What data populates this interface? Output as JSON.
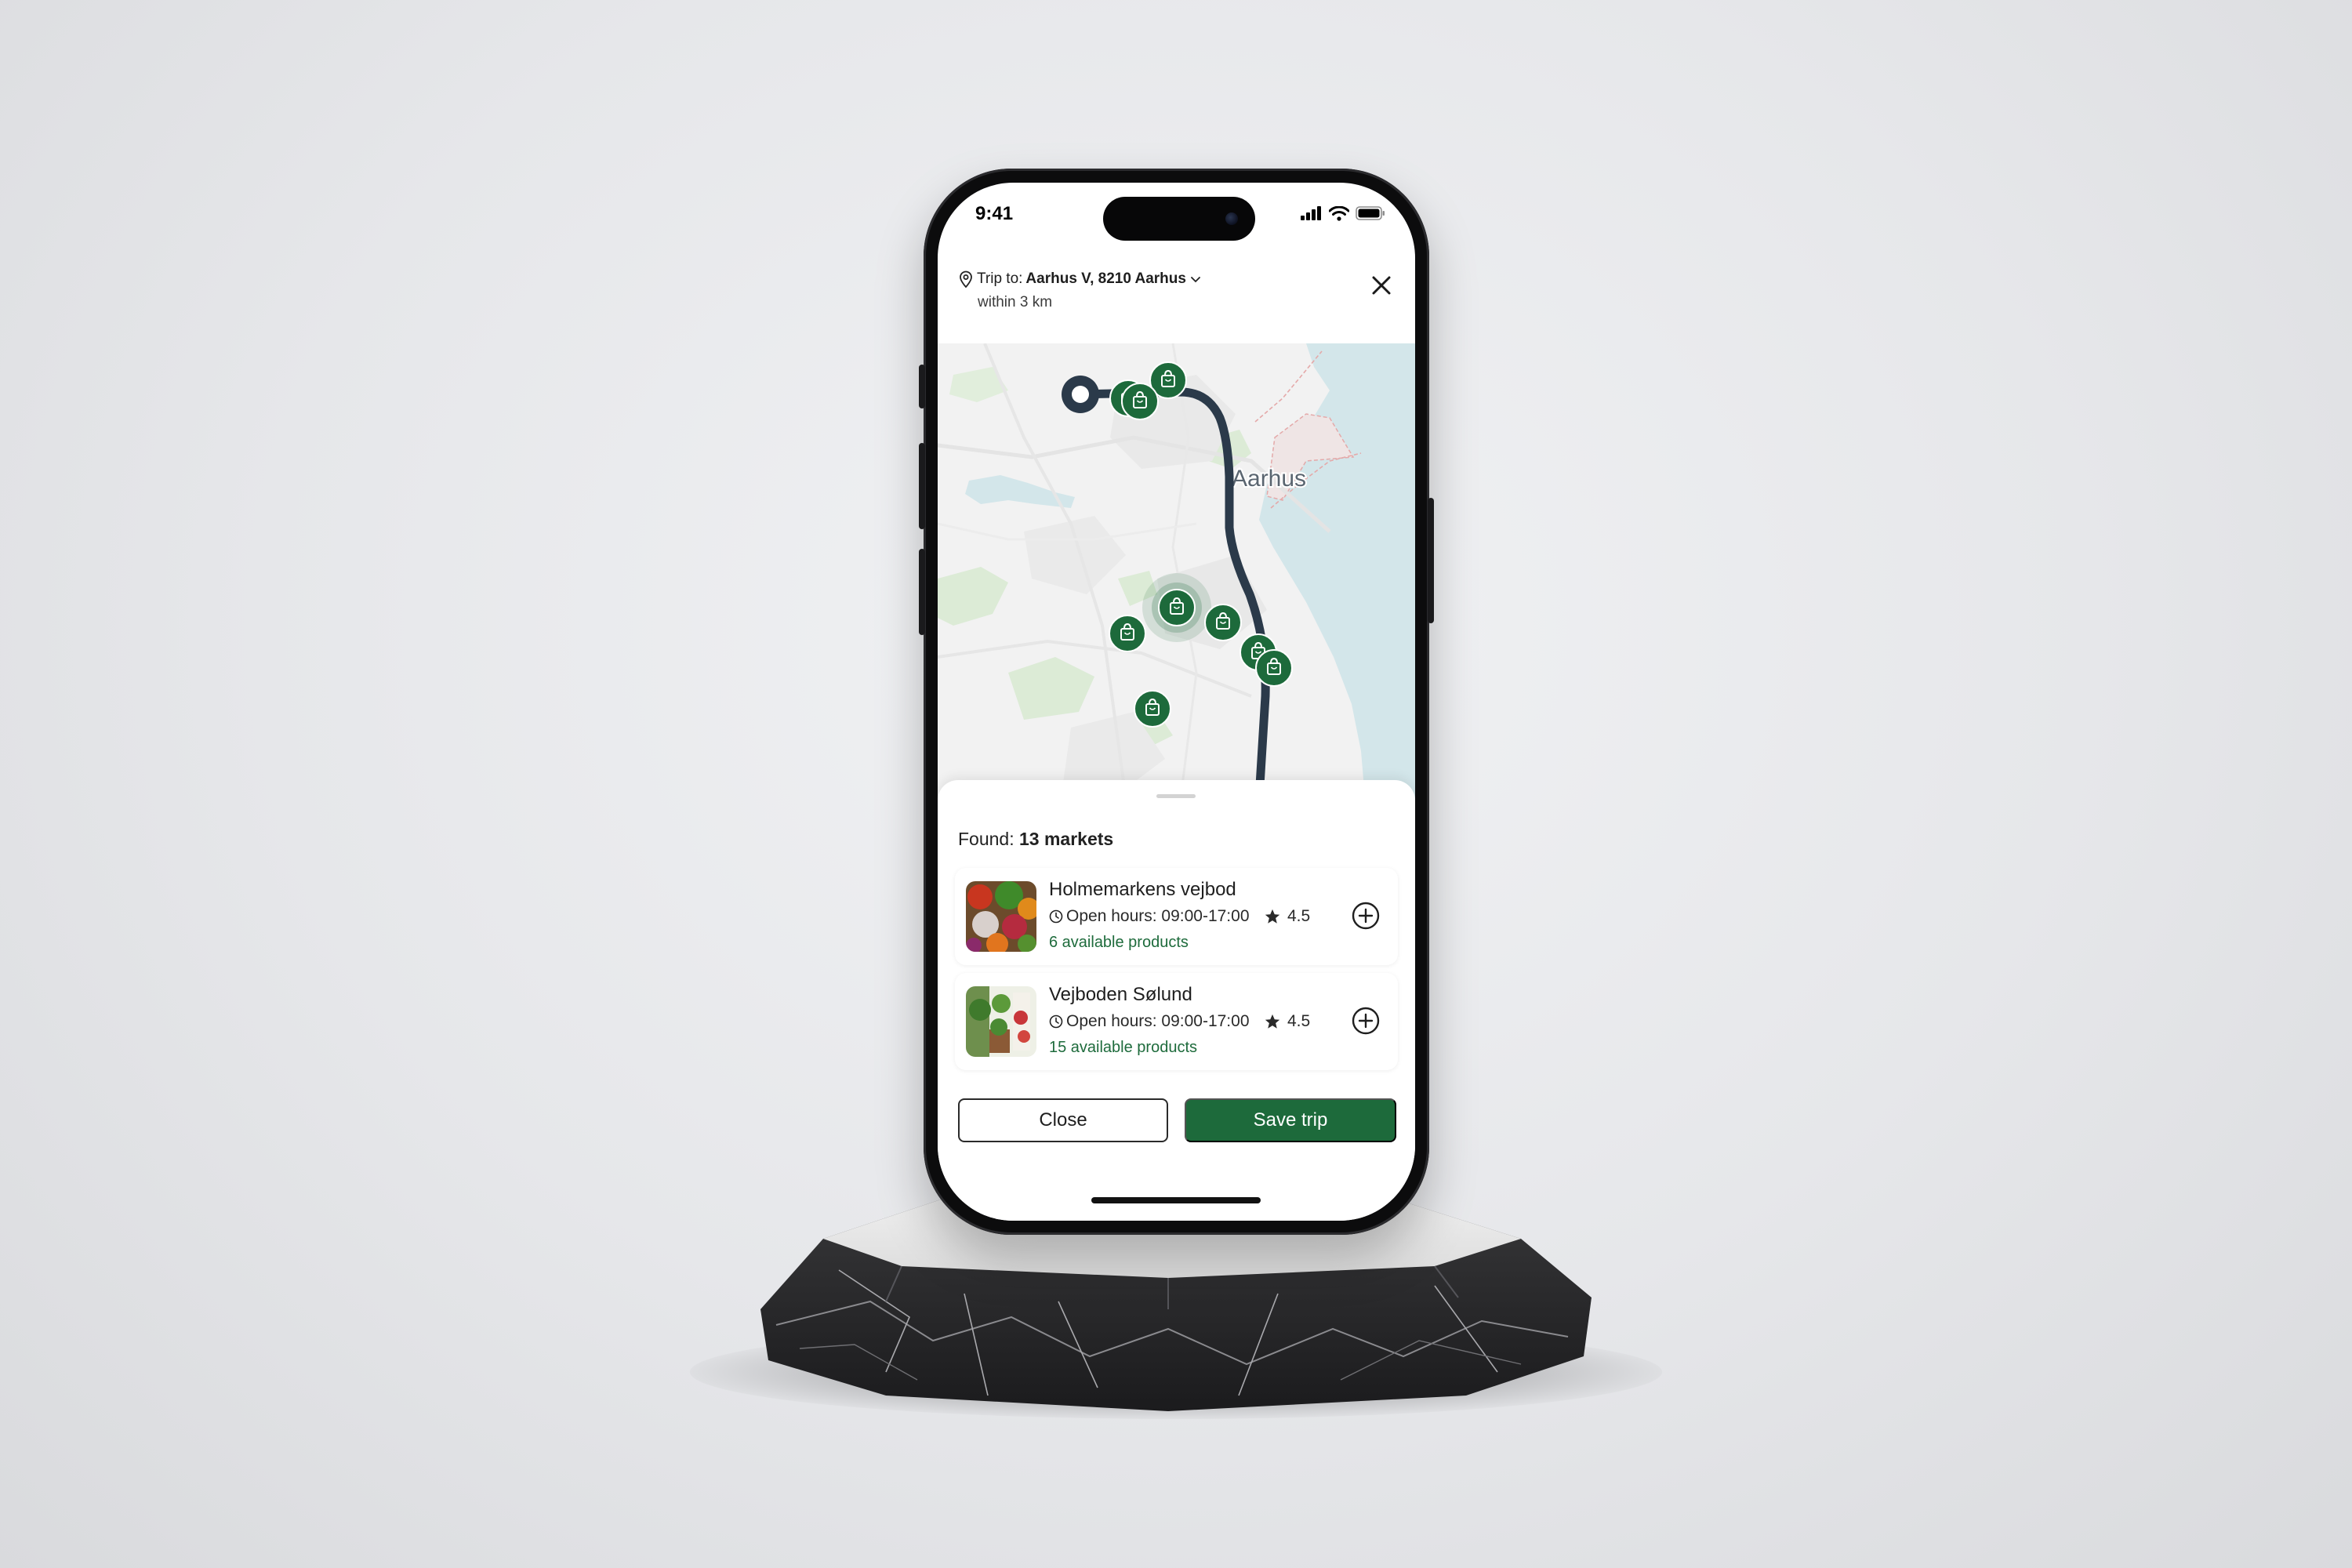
{
  "status_bar": {
    "time": "9:41"
  },
  "header": {
    "trip_prefix": "Trip to:",
    "destination": "Aarhus V, 8210 Aarhus",
    "radius": "within 3 km",
    "icons": {
      "location": "location-pin-icon",
      "dropdown": "chevron-down-icon",
      "close": "close-icon"
    }
  },
  "map": {
    "city_label": "Aarhus",
    "marker_icon": "shopping-bag-icon",
    "colors": {
      "route": "#2b3a4a",
      "marker": "#1d6a3b",
      "water": "#d3e6ea",
      "land": "#f2f2f2",
      "park": "#dcebd6"
    }
  },
  "results": {
    "found_prefix": "Found:",
    "found_count": "13 markets",
    "markets": [
      {
        "name": "Holmemarkens vejbod",
        "hours": "Open hours: 09:00-17:00",
        "rating": "4.5",
        "products": "6 available products"
      },
      {
        "name": "Vejboden Sølund",
        "hours": "Open hours: 09:00-17:00",
        "rating": "4.5",
        "products": "15 available products"
      }
    ]
  },
  "actions": {
    "close_label": "Close",
    "save_label": "Save trip"
  },
  "colors": {
    "brand_green": "#1d6a3b",
    "text": "#1e1e1e",
    "route": "#2b3a4a"
  }
}
